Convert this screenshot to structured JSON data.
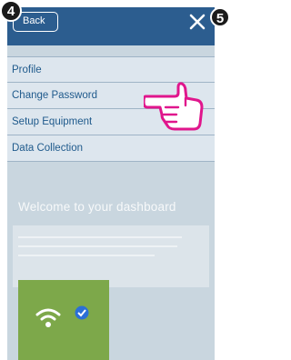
{
  "header": {
    "back_label": "Back",
    "close_icon": "close-icon"
  },
  "menu": {
    "items": [
      {
        "label": "Profile"
      },
      {
        "label": "Change Password"
      },
      {
        "label": "Setup Equipment"
      },
      {
        "label": "Data Collection"
      }
    ]
  },
  "dashboard": {
    "title": "Welcome to your dashboard"
  },
  "steps": {
    "current": "4",
    "next": "5"
  },
  "colors": {
    "header": "#2c5d8f",
    "menu_text": "#1f5a8c",
    "pointer_hand": "#e0168c",
    "tile": "#7da84a"
  }
}
